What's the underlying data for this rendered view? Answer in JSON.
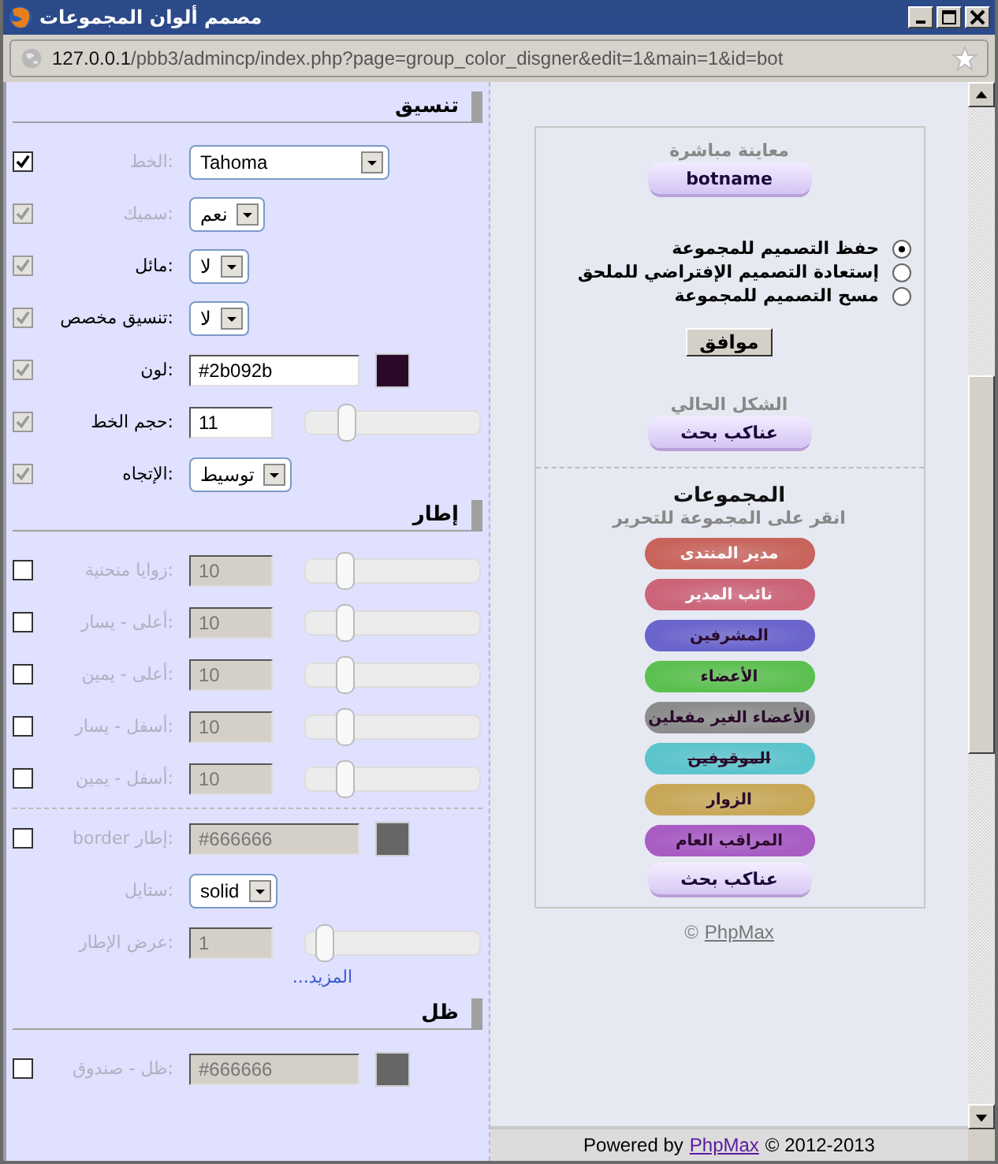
{
  "window": {
    "title": "مصمم ألوان المجموعات",
    "controls": [
      {
        "kind": "minimize"
      },
      {
        "kind": "maximize"
      },
      {
        "kind": "close"
      }
    ]
  },
  "address_bar": {
    "host": "127.0.0.1",
    "path": "/pbb3/admincp/index.php?page=group_color_disgner&edit=1&main=1&id=bot"
  },
  "sections": [
    {
      "title": "تنسيق",
      "rows": [
        {
          "kind": "select",
          "label": "الخط:",
          "checked": true,
          "check_disabled": false,
          "dimmed": true,
          "field_disabled": false,
          "separated": false,
          "value": "Tahoma",
          "wide": true
        },
        {
          "kind": "select",
          "label": "سميك:",
          "checked": true,
          "check_disabled": true,
          "dimmed": true,
          "field_disabled": false,
          "separated": false,
          "value": "نعم",
          "wide": false
        },
        {
          "kind": "select",
          "label": "مائل:",
          "checked": true,
          "check_disabled": true,
          "dimmed": false,
          "field_disabled": false,
          "separated": false,
          "value": "لا",
          "wide": false
        },
        {
          "kind": "select",
          "label": "تنسيق مخصص:",
          "checked": true,
          "check_disabled": true,
          "dimmed": false,
          "field_disabled": false,
          "separated": false,
          "value": "لا",
          "wide": false
        },
        {
          "kind": "color",
          "label": "لون:",
          "checked": true,
          "check_disabled": true,
          "dimmed": false,
          "field_disabled": false,
          "separated": false,
          "value": "#2b092b"
        },
        {
          "kind": "number",
          "label": "حجم الخط:",
          "checked": true,
          "check_disabled": true,
          "dimmed": false,
          "field_disabled": false,
          "separated": false,
          "value": "11",
          "level": 0.18
        },
        {
          "kind": "select",
          "label": "الإتجاه:",
          "checked": true,
          "check_disabled": true,
          "dimmed": false,
          "field_disabled": false,
          "separated": false,
          "value": "توسيط",
          "wide": false
        }
      ]
    },
    {
      "title": "إطار",
      "more_link": "...المزيد",
      "rows": [
        {
          "kind": "number",
          "label": "زوايا منحنية:",
          "checked": false,
          "check_disabled": false,
          "dimmed": true,
          "field_disabled": true,
          "separated": false,
          "value": "10",
          "level": 0.17
        },
        {
          "kind": "number",
          "label": "أعلى - يسار:",
          "checked": false,
          "check_disabled": false,
          "dimmed": true,
          "field_disabled": true,
          "separated": false,
          "value": "10",
          "level": 0.17
        },
        {
          "kind": "number",
          "label": "أعلى - يمين:",
          "checked": false,
          "check_disabled": false,
          "dimmed": true,
          "field_disabled": true,
          "separated": false,
          "value": "10",
          "level": 0.17
        },
        {
          "kind": "number",
          "label": "أسفل - يسار:",
          "checked": false,
          "check_disabled": false,
          "dimmed": true,
          "field_disabled": true,
          "separated": false,
          "value": "10",
          "level": 0.17
        },
        {
          "kind": "number",
          "label": "أسفل - يمين:",
          "checked": false,
          "check_disabled": false,
          "dimmed": true,
          "field_disabled": true,
          "separated": false,
          "value": "10",
          "level": 0.17
        },
        {
          "kind": "color",
          "label": "border إطار:",
          "checked": false,
          "check_disabled": false,
          "dimmed": true,
          "field_disabled": true,
          "separated": true,
          "value": "#666666"
        },
        {
          "kind": "select",
          "label": "ستايل:",
          "checkbox": false,
          "dimmed": true,
          "field_disabled": false,
          "separated": false,
          "value": "solid",
          "wide": false
        },
        {
          "kind": "number",
          "label": "عرض الإطار:",
          "checkbox": false,
          "dimmed": true,
          "field_disabled": true,
          "separated": false,
          "value": "1",
          "level": 0.05
        }
      ]
    },
    {
      "title": "ظل",
      "rows": [
        {
          "kind": "color",
          "label": "ظل - صندوق:",
          "checked": false,
          "check_disabled": false,
          "dimmed": true,
          "field_disabled": true,
          "separated": false,
          "value": "#666666"
        }
      ]
    }
  ],
  "preview": {
    "heading": "معاينة مباشرة",
    "name": "botname",
    "options": [
      {
        "label": "حفظ التصميم للمجموعة",
        "selected": true
      },
      {
        "label": "إستعادة التصميم الإفتراضي للملحق",
        "selected": false
      },
      {
        "label": "مسح التصميم للمجموعة",
        "selected": false
      }
    ],
    "submit": "موافق",
    "current_heading": "الشكل الحالي",
    "current": "عناكب بحث"
  },
  "groups": {
    "title": "المجموعات",
    "hint": "انقر على المجموعة للتحرير",
    "items": [
      {
        "kind": "tinted",
        "label": "مدير المنتدى",
        "color": "#c8645c",
        "strike": false
      },
      {
        "kind": "tinted",
        "label": "نائب المدير",
        "color": "#cc6478",
        "strike": false
      },
      {
        "kind": "tinted",
        "label": "المشرفين",
        "color": "#6a64cc",
        "strike": false
      },
      {
        "kind": "tinted",
        "label": "الأعضاء",
        "color": "#5cc050",
        "strike": false
      },
      {
        "kind": "tinted",
        "label": "الأعضاء الغير مفعلين",
        "color": "#8c8c8c",
        "strike": false
      },
      {
        "kind": "tinted",
        "label": "الموقوفين",
        "color": "#5cc4cc",
        "strike": true
      },
      {
        "kind": "tinted",
        "label": "الزوار",
        "color": "#c8a858",
        "strike": false
      },
      {
        "kind": "tinted",
        "label": "المراقب العام",
        "color": "#a85cc4",
        "strike": false
      },
      {
        "kind": "plain",
        "label": "عناكب بحث",
        "color": "#d8c8f4",
        "strike": false
      }
    ]
  },
  "copyright": {
    "symbol": "©",
    "link": "PhpMax"
  },
  "footer": {
    "before": "Powered by",
    "link": "PhpMax",
    "after": "© 2012-2013"
  }
}
